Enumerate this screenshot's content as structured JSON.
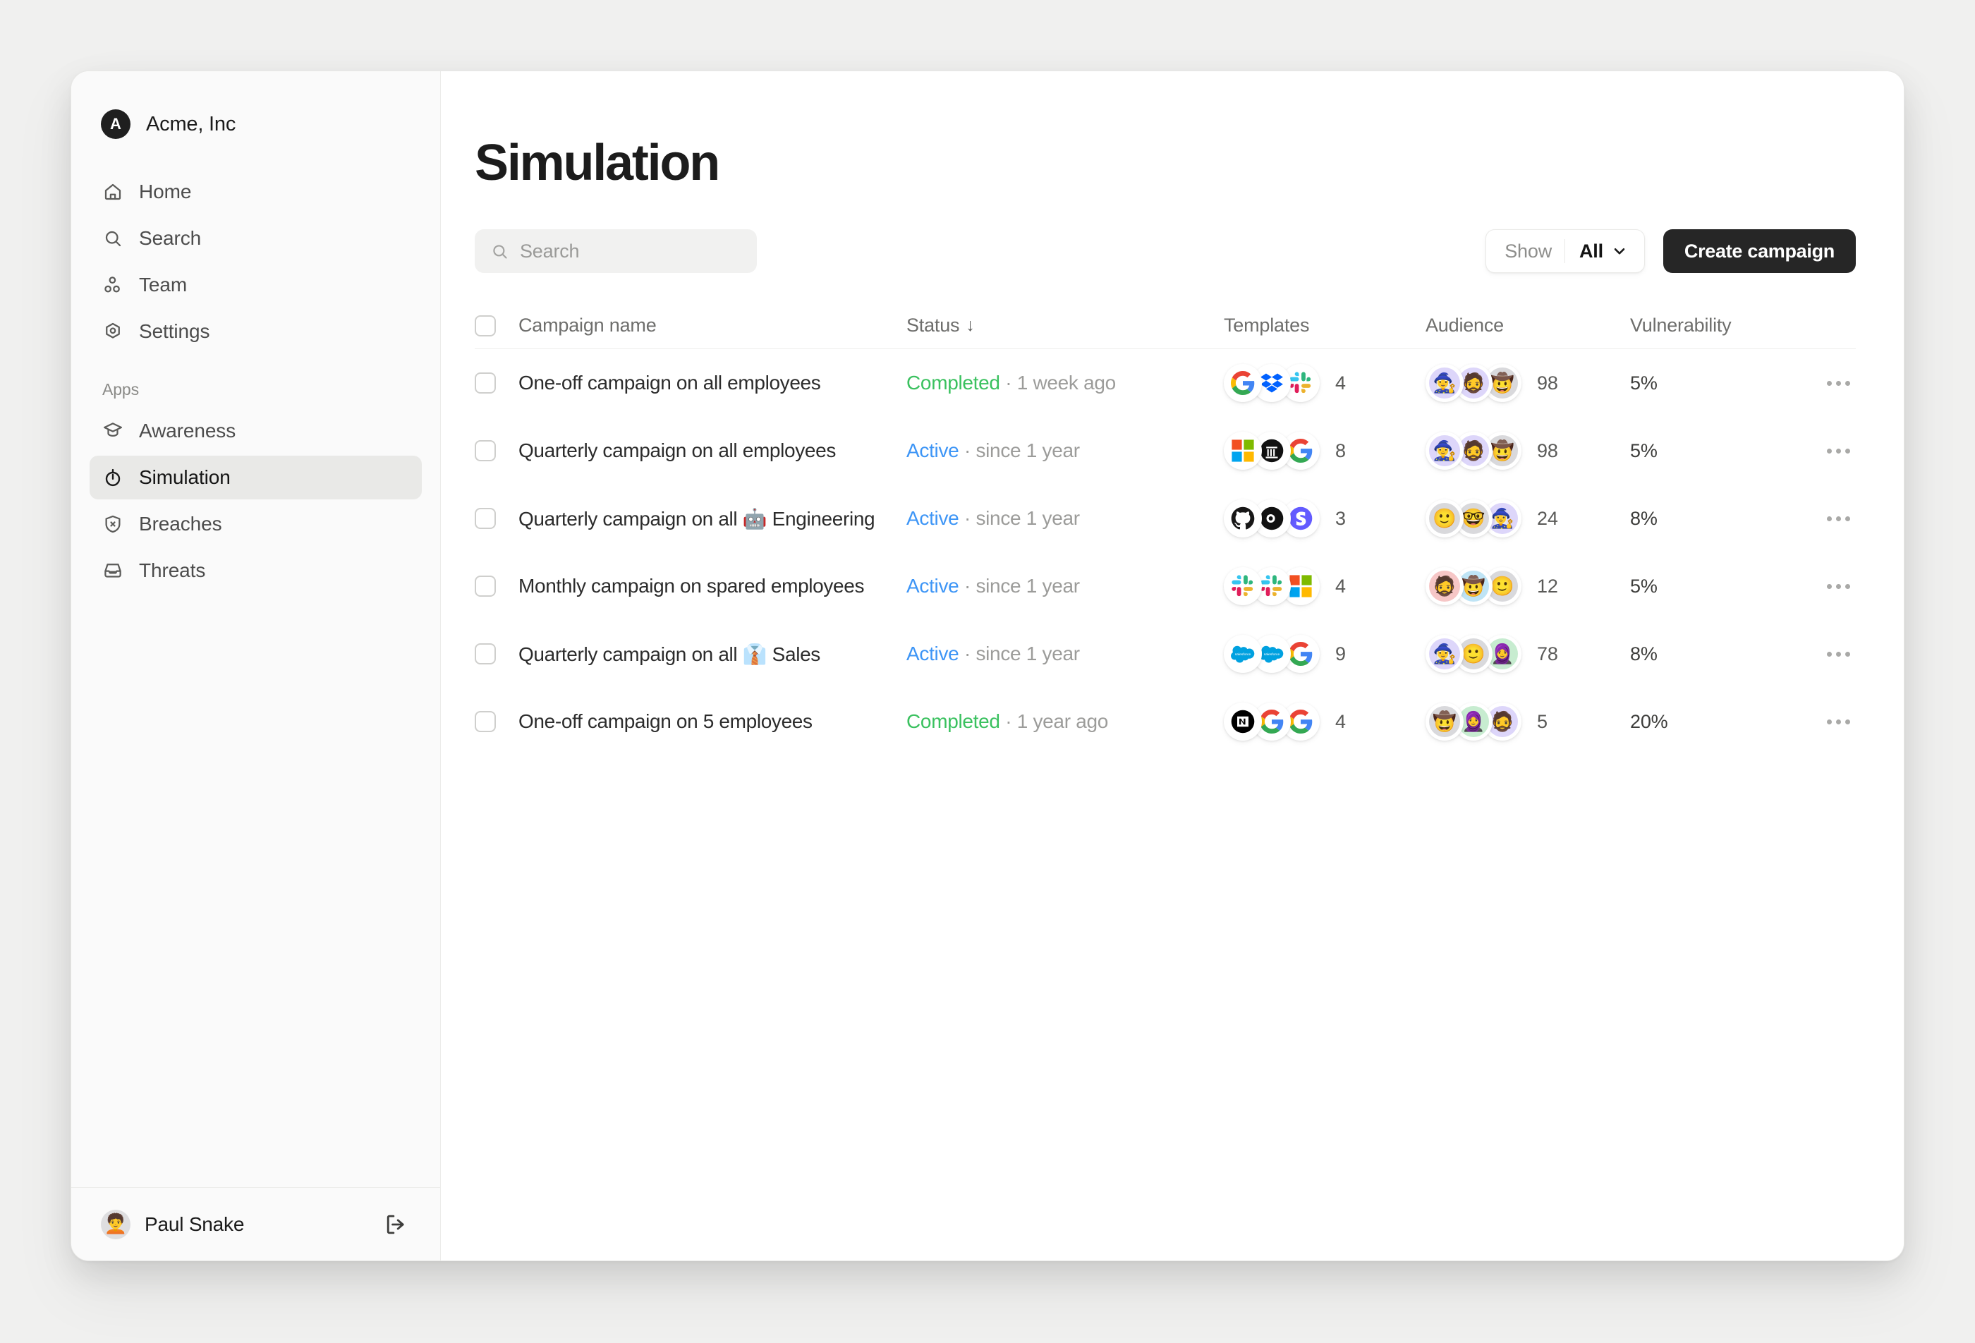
{
  "sidebar": {
    "org": {
      "avatar_letter": "A",
      "name": "Acme, Inc"
    },
    "nav": [
      {
        "label": "Home",
        "icon": "home-icon"
      },
      {
        "label": "Search",
        "icon": "search-icon"
      },
      {
        "label": "Team",
        "icon": "team-icon"
      },
      {
        "label": "Settings",
        "icon": "settings-icon"
      }
    ],
    "apps_label": "Apps",
    "apps": [
      {
        "label": "Awareness",
        "icon": "graduation-cap-icon",
        "active": false
      },
      {
        "label": "Simulation",
        "icon": "stopwatch-icon",
        "active": true
      },
      {
        "label": "Breaches",
        "icon": "shield-x-icon",
        "active": false
      },
      {
        "label": "Threats",
        "icon": "inbox-icon",
        "active": false
      }
    ],
    "footer": {
      "user_name": "Paul Snake",
      "avatar_emoji": "🧑‍🦱",
      "logout_icon": "logout-icon"
    }
  },
  "main": {
    "title": "Simulation",
    "search": {
      "placeholder": "Search",
      "value": "",
      "icon": "search-icon"
    },
    "show_filter": {
      "label": "Show",
      "value": "All",
      "chevron": "chevron-down-icon"
    },
    "create_button": "Create campaign"
  },
  "table": {
    "headers": {
      "name": "Campaign name",
      "status": "Status",
      "status_sort": "↓",
      "templates": "Templates",
      "audience": "Audience",
      "vulnerability": "Vulnerability"
    },
    "rows": [
      {
        "name": "One-off campaign on all employees",
        "emoji": "",
        "status": "Completed",
        "status_kind": "completed",
        "status_meta": "· 1 week ago",
        "templates": [
          "google",
          "dropbox",
          "slack"
        ],
        "template_count": "4",
        "avatars": [
          "🧙‍♀️",
          "🧔",
          "🤠"
        ],
        "audience_count": "98",
        "vulnerability": "5%",
        "menu": "row-menu"
      },
      {
        "name": "Quarterly campaign on all employees",
        "emoji": "",
        "status": "Active",
        "status_kind": "active",
        "status_meta": "· since 1 year",
        "templates": [
          "microsoft",
          "bank",
          "google"
        ],
        "template_count": "8",
        "avatars": [
          "🧙‍♀️",
          "🧔",
          "🤠"
        ],
        "audience_count": "98",
        "vulnerability": "5%",
        "menu": "row-menu"
      },
      {
        "name": "Quarterly campaign on all 🤖 Engineering",
        "emoji": "🤖",
        "status": "Active",
        "status_kind": "active",
        "status_meta": "· since 1 year",
        "templates": [
          "github",
          "circleci",
          "stripe"
        ],
        "template_count": "3",
        "avatars": [
          "🙂",
          "🤓",
          "🧙‍♀️"
        ],
        "audience_count": "24",
        "vulnerability": "8%",
        "menu": "row-menu"
      },
      {
        "name": "Monthly campaign on spared employees",
        "emoji": "",
        "status": "Active",
        "status_kind": "active",
        "status_meta": "· since 1 year",
        "templates": [
          "slack",
          "slack",
          "microsoft"
        ],
        "template_count": "4",
        "avatars": [
          "🧔",
          "🤠",
          "🙂"
        ],
        "audience_count": "12",
        "vulnerability": "5%",
        "menu": "row-menu"
      },
      {
        "name": "Quarterly campaign on all 👔 Sales",
        "emoji": "👔",
        "status": "Active",
        "status_kind": "active",
        "status_meta": "· since 1 year",
        "templates": [
          "salesforce",
          "salesforce",
          "google"
        ],
        "template_count": "9",
        "avatars": [
          "🧙‍♀️",
          "🙂",
          "🧕"
        ],
        "audience_count": "78",
        "vulnerability": "8%",
        "menu": "row-menu"
      },
      {
        "name": "One-off campaign on 5 employees",
        "emoji": "",
        "status": "Completed",
        "status_kind": "completed",
        "status_meta": "· 1 year ago",
        "templates": [
          "notion",
          "google",
          "google"
        ],
        "template_count": "4",
        "avatars": [
          "🤠",
          "🧕",
          "🧔"
        ],
        "audience_count": "5",
        "vulnerability": "20%",
        "menu": "row-menu"
      }
    ]
  },
  "colors": {
    "status_completed": "#3ac15f",
    "status_active": "#3d95f6",
    "accent_dark": "#262626",
    "sidebar_bg": "#fafafa",
    "active_item_bg": "#e9e9e7"
  }
}
